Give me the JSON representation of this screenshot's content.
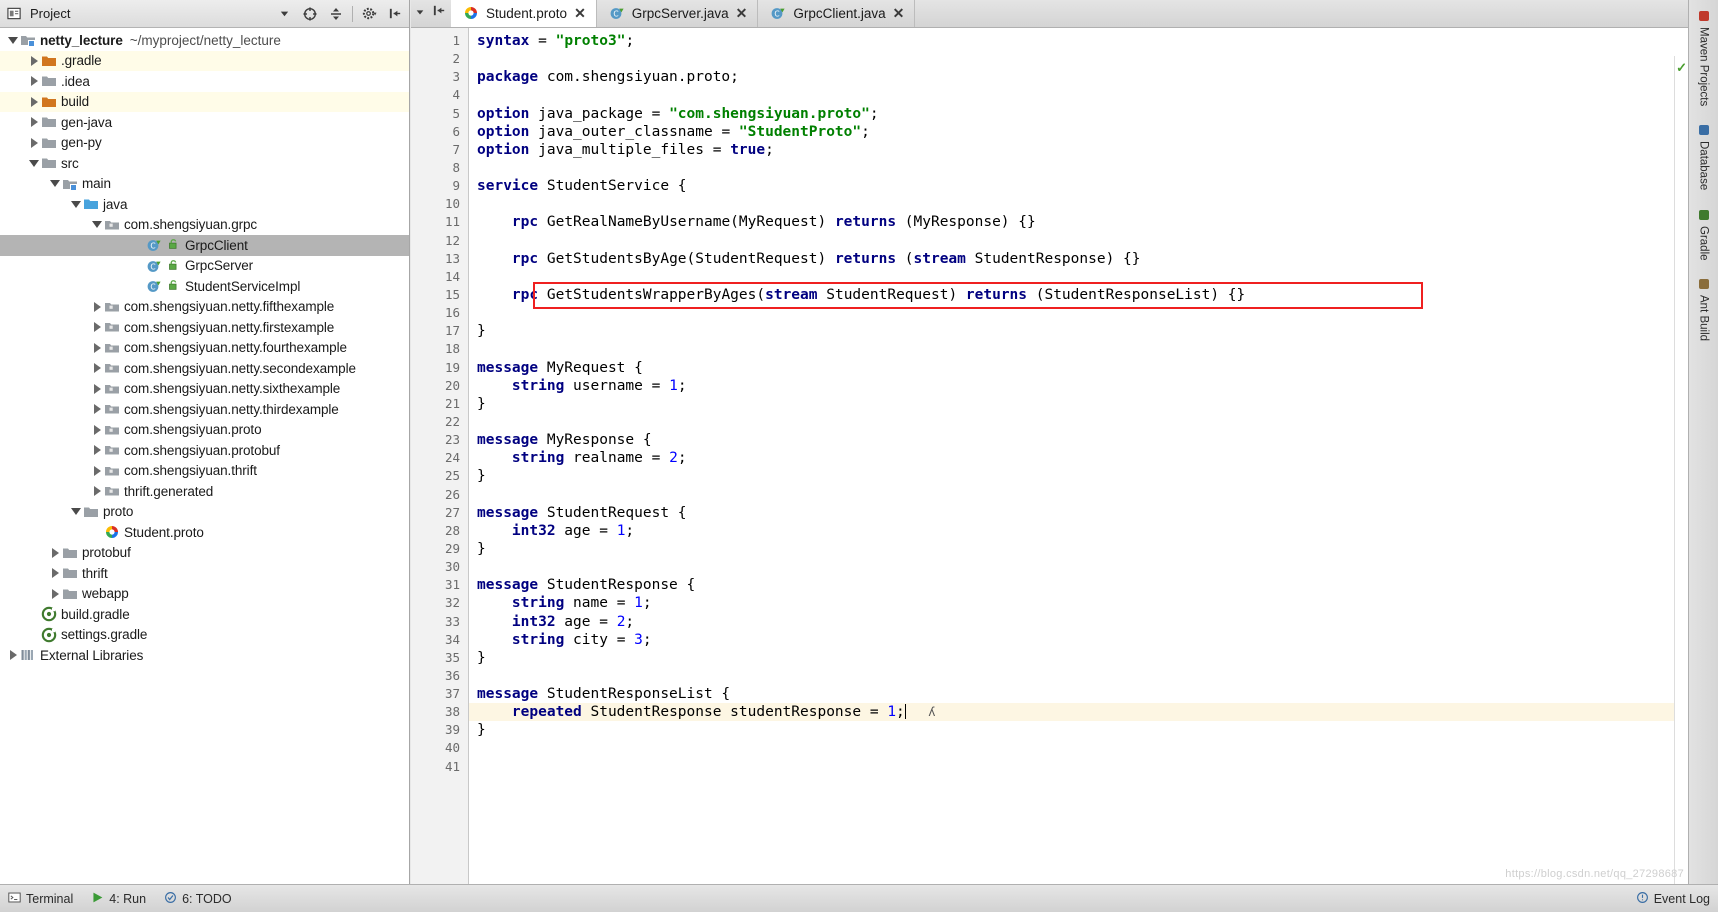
{
  "project_panel": {
    "title": "Project",
    "toolbar_icons": [
      "collapse-target-icon",
      "divide-icon",
      "settings-gear-icon",
      "hide-panel-icon"
    ],
    "tree": [
      {
        "label": "netty_lecture",
        "sub": "~/myproject/netty_lecture",
        "indent": 0,
        "arrow": "down",
        "icon": "module-folder-icon",
        "bold": true,
        "state": "normal"
      },
      {
        "label": ".gradle",
        "indent": 1,
        "arrow": "right",
        "icon": "excluded-folder-icon",
        "state": "excluded"
      },
      {
        "label": ".idea",
        "indent": 1,
        "arrow": "right",
        "icon": "folder-icon",
        "state": "normal"
      },
      {
        "label": "build",
        "indent": 1,
        "arrow": "right",
        "icon": "excluded-folder-icon",
        "state": "excluded"
      },
      {
        "label": "gen-java",
        "indent": 1,
        "arrow": "right",
        "icon": "folder-icon",
        "state": "normal"
      },
      {
        "label": "gen-py",
        "indent": 1,
        "arrow": "right",
        "icon": "folder-icon",
        "state": "normal"
      },
      {
        "label": "src",
        "indent": 1,
        "arrow": "down",
        "icon": "folder-icon",
        "state": "normal"
      },
      {
        "label": "main",
        "indent": 2,
        "arrow": "down",
        "icon": "module-folder-icon",
        "state": "normal"
      },
      {
        "label": "java",
        "indent": 3,
        "arrow": "down",
        "icon": "source-root-folder-icon",
        "state": "normal"
      },
      {
        "label": "com.shengsiyuan.grpc",
        "indent": 4,
        "arrow": "down",
        "icon": "package-icon",
        "state": "normal"
      },
      {
        "label": "GrpcClient",
        "indent": 6,
        "arrow": "none",
        "icon": "java-class-icon",
        "state": "selected"
      },
      {
        "label": "GrpcServer",
        "indent": 6,
        "arrow": "none",
        "icon": "java-class-icon",
        "state": "normal"
      },
      {
        "label": "StudentServiceImpl",
        "indent": 6,
        "arrow": "none",
        "icon": "java-class-icon",
        "state": "normal"
      },
      {
        "label": "com.shengsiyuan.netty.fifthexample",
        "indent": 4,
        "arrow": "right",
        "icon": "package-icon",
        "state": "normal"
      },
      {
        "label": "com.shengsiyuan.netty.firstexample",
        "indent": 4,
        "arrow": "right",
        "icon": "package-icon",
        "state": "normal"
      },
      {
        "label": "com.shengsiyuan.netty.fourthexample",
        "indent": 4,
        "arrow": "right",
        "icon": "package-icon",
        "state": "normal"
      },
      {
        "label": "com.shengsiyuan.netty.secondexample",
        "indent": 4,
        "arrow": "right",
        "icon": "package-icon",
        "state": "normal"
      },
      {
        "label": "com.shengsiyuan.netty.sixthexample",
        "indent": 4,
        "arrow": "right",
        "icon": "package-icon",
        "state": "normal"
      },
      {
        "label": "com.shengsiyuan.netty.thirdexample",
        "indent": 4,
        "arrow": "right",
        "icon": "package-icon",
        "state": "normal"
      },
      {
        "label": "com.shengsiyuan.proto",
        "indent": 4,
        "arrow": "right",
        "icon": "package-icon",
        "state": "normal"
      },
      {
        "label": "com.shengsiyuan.protobuf",
        "indent": 4,
        "arrow": "right",
        "icon": "package-icon",
        "state": "normal"
      },
      {
        "label": "com.shengsiyuan.thrift",
        "indent": 4,
        "arrow": "right",
        "icon": "package-icon",
        "state": "normal"
      },
      {
        "label": "thrift.generated",
        "indent": 4,
        "arrow": "right",
        "icon": "package-icon",
        "state": "normal"
      },
      {
        "label": "proto",
        "indent": 3,
        "arrow": "down",
        "icon": "folder-icon",
        "state": "normal"
      },
      {
        "label": "Student.proto",
        "indent": 4,
        "arrow": "none",
        "icon": "protobuf-file-icon",
        "state": "normal"
      },
      {
        "label": "protobuf",
        "indent": 2,
        "arrow": "right",
        "icon": "folder-icon",
        "state": "normal"
      },
      {
        "label": "thrift",
        "indent": 2,
        "arrow": "right",
        "icon": "folder-icon",
        "state": "normal"
      },
      {
        "label": "webapp",
        "indent": 2,
        "arrow": "right",
        "icon": "folder-icon",
        "state": "normal"
      },
      {
        "label": "build.gradle",
        "indent": 1,
        "arrow": "none",
        "icon": "gradle-file-icon",
        "state": "normal"
      },
      {
        "label": "settings.gradle",
        "indent": 1,
        "arrow": "none",
        "icon": "gradle-file-icon",
        "state": "normal"
      },
      {
        "label": "External Libraries",
        "indent": 0,
        "arrow": "right",
        "icon": "libraries-icon",
        "state": "normal"
      }
    ]
  },
  "editor": {
    "tabs": [
      {
        "label": "Student.proto",
        "icon": "protobuf-file-icon",
        "active": true,
        "close": "✕"
      },
      {
        "label": "GrpcServer.java",
        "icon": "java-class-icon",
        "active": false,
        "close": "✕"
      },
      {
        "label": "GrpcClient.java",
        "icon": "java-class-icon",
        "active": false,
        "close": "✕"
      }
    ],
    "first_line_number": 1,
    "last_line_number": 41,
    "caret_line": 38,
    "highlight_box_line": 15,
    "inspection_status": "ok",
    "lines": [
      {
        "n": 1,
        "tokens": [
          {
            "t": "syntax",
            "c": "kw"
          },
          {
            "t": " = ",
            "c": "pl"
          },
          {
            "t": "\"proto3\"",
            "c": "str"
          },
          {
            "t": ";",
            "c": "pl"
          }
        ]
      },
      {
        "n": 2,
        "tokens": []
      },
      {
        "n": 3,
        "tokens": [
          {
            "t": "package",
            "c": "kw"
          },
          {
            "t": " com.shengsiyuan.proto;",
            "c": "pl"
          }
        ]
      },
      {
        "n": 4,
        "tokens": []
      },
      {
        "n": 5,
        "tokens": [
          {
            "t": "option",
            "c": "kw"
          },
          {
            "t": " java_package = ",
            "c": "pl"
          },
          {
            "t": "\"com.shengsiyuan.proto\"",
            "c": "str"
          },
          {
            "t": ";",
            "c": "pl"
          }
        ]
      },
      {
        "n": 6,
        "tokens": [
          {
            "t": "option",
            "c": "kw"
          },
          {
            "t": " java_outer_classname = ",
            "c": "pl"
          },
          {
            "t": "\"StudentProto\"",
            "c": "str"
          },
          {
            "t": ";",
            "c": "pl"
          }
        ]
      },
      {
        "n": 7,
        "tokens": [
          {
            "t": "option",
            "c": "kw"
          },
          {
            "t": " java_multiple_files = ",
            "c": "pl"
          },
          {
            "t": "true",
            "c": "kw"
          },
          {
            "t": ";",
            "c": "pl"
          }
        ]
      },
      {
        "n": 8,
        "tokens": []
      },
      {
        "n": 9,
        "tokens": [
          {
            "t": "service",
            "c": "kw"
          },
          {
            "t": " StudentService {",
            "c": "pl"
          }
        ]
      },
      {
        "n": 10,
        "tokens": []
      },
      {
        "n": 11,
        "tokens": [
          {
            "t": "    ",
            "c": "pl"
          },
          {
            "t": "rpc",
            "c": "kw"
          },
          {
            "t": " GetRealNameByUsername(MyRequest) ",
            "c": "pl"
          },
          {
            "t": "returns",
            "c": "kw"
          },
          {
            "t": " (MyResponse) {}",
            "c": "pl"
          }
        ]
      },
      {
        "n": 12,
        "tokens": []
      },
      {
        "n": 13,
        "tokens": [
          {
            "t": "    ",
            "c": "pl"
          },
          {
            "t": "rpc",
            "c": "kw"
          },
          {
            "t": " GetStudentsByAge(StudentRequest) ",
            "c": "pl"
          },
          {
            "t": "returns",
            "c": "kw"
          },
          {
            "t": " (",
            "c": "pl"
          },
          {
            "t": "stream",
            "c": "kw"
          },
          {
            "t": " StudentResponse) {}",
            "c": "pl"
          }
        ]
      },
      {
        "n": 14,
        "tokens": []
      },
      {
        "n": 15,
        "tokens": [
          {
            "t": "    ",
            "c": "pl"
          },
          {
            "t": "rpc",
            "c": "kw"
          },
          {
            "t": " GetStudentsWrapperByAges(",
            "c": "pl"
          },
          {
            "t": "stream",
            "c": "kw"
          },
          {
            "t": " StudentRequest) ",
            "c": "pl"
          },
          {
            "t": "returns",
            "c": "kw"
          },
          {
            "t": " (StudentResponseList) {}",
            "c": "pl"
          }
        ]
      },
      {
        "n": 16,
        "tokens": []
      },
      {
        "n": 17,
        "tokens": [
          {
            "t": "}",
            "c": "pl"
          }
        ]
      },
      {
        "n": 18,
        "tokens": []
      },
      {
        "n": 19,
        "tokens": [
          {
            "t": "message",
            "c": "kw"
          },
          {
            "t": " MyRequest {",
            "c": "pl"
          }
        ]
      },
      {
        "n": 20,
        "tokens": [
          {
            "t": "    ",
            "c": "pl"
          },
          {
            "t": "string",
            "c": "kw"
          },
          {
            "t": " username = ",
            "c": "pl"
          },
          {
            "t": "1",
            "c": "num"
          },
          {
            "t": ";",
            "c": "pl"
          }
        ]
      },
      {
        "n": 21,
        "tokens": [
          {
            "t": "}",
            "c": "pl"
          }
        ]
      },
      {
        "n": 22,
        "tokens": []
      },
      {
        "n": 23,
        "tokens": [
          {
            "t": "message",
            "c": "kw"
          },
          {
            "t": " MyResponse {",
            "c": "pl"
          }
        ]
      },
      {
        "n": 24,
        "tokens": [
          {
            "t": "    ",
            "c": "pl"
          },
          {
            "t": "string",
            "c": "kw"
          },
          {
            "t": " realname = ",
            "c": "pl"
          },
          {
            "t": "2",
            "c": "num"
          },
          {
            "t": ";",
            "c": "pl"
          }
        ]
      },
      {
        "n": 25,
        "tokens": [
          {
            "t": "}",
            "c": "pl"
          }
        ]
      },
      {
        "n": 26,
        "tokens": []
      },
      {
        "n": 27,
        "tokens": [
          {
            "t": "message",
            "c": "kw"
          },
          {
            "t": " StudentRequest {",
            "c": "pl"
          }
        ]
      },
      {
        "n": 28,
        "tokens": [
          {
            "t": "    ",
            "c": "pl"
          },
          {
            "t": "int32",
            "c": "kw"
          },
          {
            "t": " age = ",
            "c": "pl"
          },
          {
            "t": "1",
            "c": "num"
          },
          {
            "t": ";",
            "c": "pl"
          }
        ]
      },
      {
        "n": 29,
        "tokens": [
          {
            "t": "}",
            "c": "pl"
          }
        ]
      },
      {
        "n": 30,
        "tokens": []
      },
      {
        "n": 31,
        "tokens": [
          {
            "t": "message",
            "c": "kw"
          },
          {
            "t": " StudentResponse {",
            "c": "pl"
          }
        ]
      },
      {
        "n": 32,
        "tokens": [
          {
            "t": "    ",
            "c": "pl"
          },
          {
            "t": "string",
            "c": "kw"
          },
          {
            "t": " name = ",
            "c": "pl"
          },
          {
            "t": "1",
            "c": "num"
          },
          {
            "t": ";",
            "c": "pl"
          }
        ]
      },
      {
        "n": 33,
        "tokens": [
          {
            "t": "    ",
            "c": "pl"
          },
          {
            "t": "int32",
            "c": "kw"
          },
          {
            "t": " age = ",
            "c": "pl"
          },
          {
            "t": "2",
            "c": "num"
          },
          {
            "t": ";",
            "c": "pl"
          }
        ]
      },
      {
        "n": 34,
        "tokens": [
          {
            "t": "    ",
            "c": "pl"
          },
          {
            "t": "string",
            "c": "kw"
          },
          {
            "t": " city = ",
            "c": "pl"
          },
          {
            "t": "3",
            "c": "num"
          },
          {
            "t": ";",
            "c": "pl"
          }
        ]
      },
      {
        "n": 35,
        "tokens": [
          {
            "t": "}",
            "c": "pl"
          }
        ]
      },
      {
        "n": 36,
        "tokens": []
      },
      {
        "n": 37,
        "tokens": [
          {
            "t": "message",
            "c": "kw"
          },
          {
            "t": " StudentResponseList {",
            "c": "pl"
          }
        ]
      },
      {
        "n": 38,
        "tokens": [
          {
            "t": "    ",
            "c": "pl"
          },
          {
            "t": "repeated",
            "c": "kw"
          },
          {
            "t": " StudentResponse studentResponse = ",
            "c": "pl"
          },
          {
            "t": "1",
            "c": "num"
          },
          {
            "t": ";",
            "c": "pl"
          }
        ]
      },
      {
        "n": 39,
        "tokens": [
          {
            "t": "}",
            "c": "pl"
          }
        ]
      },
      {
        "n": 40,
        "tokens": []
      },
      {
        "n": 41,
        "tokens": []
      }
    ]
  },
  "right_toolbar": {
    "items": [
      {
        "label": "Maven Projects",
        "icon": "maven-icon"
      },
      {
        "label": "Database",
        "icon": "database-icon"
      },
      {
        "label": "Gradle",
        "icon": "gradle-icon"
      },
      {
        "label": "Ant Build",
        "icon": "ant-icon"
      }
    ]
  },
  "status_bar": {
    "left_items": [
      {
        "label": "Terminal",
        "icon": "terminal-icon"
      },
      {
        "label": "4: Run",
        "icon": "run-icon"
      },
      {
        "label": "6: TODO",
        "icon": "todo-icon"
      }
    ],
    "right_items": [
      {
        "label": "Event Log",
        "icon": "event-log-icon"
      }
    ]
  },
  "watermark": {
    "text": "https://blog.csdn.net/qq_27298687"
  },
  "colors": {
    "keyword": "#000080",
    "string": "#008000",
    "number": "#0000ff",
    "highlight_box": "#ef2020",
    "caret_line_bg": "#fdf6e3",
    "excluded_row_bg": "#fffce8",
    "selected_row_bg": "#b4b4b4"
  }
}
